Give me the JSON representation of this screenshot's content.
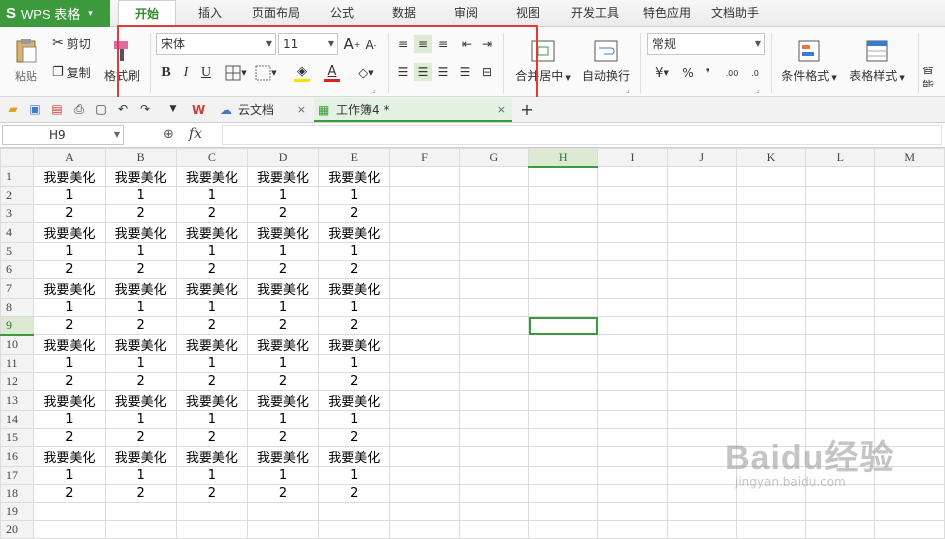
{
  "app": {
    "logo": "S",
    "name": "WPS 表格",
    "caret": "▾"
  },
  "menu_tabs": [
    "开始",
    "插入",
    "页面布局",
    "公式",
    "数据",
    "审阅",
    "视图",
    "开发工具",
    "特色应用",
    "文档助手"
  ],
  "ribbon": {
    "paste": "粘贴",
    "cut": "剪切",
    "copy": "复制",
    "format_painter": "格式刷",
    "font_name": "宋体",
    "font_size": "11",
    "merge_center": "合并居中",
    "auto_wrap": "自动换行",
    "number_format": "常规",
    "conditional_format": "条件格式",
    "table_style": "表格样式",
    "smart": "智能",
    "bold": "B",
    "italic": "I",
    "underline": "U",
    "grow_font": "A",
    "shrink_font": "A",
    "percent": "%",
    "comma": "❜",
    "inc_decimal": ".00",
    "dec_decimal": ".0",
    "font_color_bar": "#e02020",
    "fill_color_bar": "#f5e300"
  },
  "doc_tabs": [
    {
      "label": "",
      "close": "×"
    },
    {
      "label": "云文档",
      "close": "×"
    },
    {
      "label": "工作簿4 *",
      "close": "×"
    }
  ],
  "doc_tab_add": "+",
  "formula_bar": {
    "cell_ref": "H9",
    "fx": "fx",
    "value": ""
  },
  "sheet": {
    "columns": [
      "A",
      "B",
      "C",
      "D",
      "E",
      "F",
      "G",
      "H",
      "I",
      "J",
      "K",
      "L",
      "M"
    ],
    "selected_column": "H",
    "selected_row": "9",
    "rows": [
      {
        "n": "1",
        "cells": [
          "我要美化",
          "我要美化",
          "我要美化",
          "我要美化",
          "我要美化"
        ]
      },
      {
        "n": "2",
        "cells": [
          "1",
          "1",
          "1",
          "1",
          "1"
        ]
      },
      {
        "n": "3",
        "cells": [
          "2",
          "2",
          "2",
          "2",
          "2"
        ]
      },
      {
        "n": "4",
        "cells": [
          "我要美化",
          "我要美化",
          "我要美化",
          "我要美化",
          "我要美化"
        ]
      },
      {
        "n": "5",
        "cells": [
          "1",
          "1",
          "1",
          "1",
          "1"
        ]
      },
      {
        "n": "6",
        "cells": [
          "2",
          "2",
          "2",
          "2",
          "2"
        ]
      },
      {
        "n": "7",
        "cells": [
          "我要美化",
          "我要美化",
          "我要美化",
          "我要美化",
          "我要美化"
        ]
      },
      {
        "n": "8",
        "cells": [
          "1",
          "1",
          "1",
          "1",
          "1"
        ]
      },
      {
        "n": "9",
        "cells": [
          "2",
          "2",
          "2",
          "2",
          "2"
        ]
      },
      {
        "n": "10",
        "cells": [
          "我要美化",
          "我要美化",
          "我要美化",
          "我要美化",
          "我要美化"
        ]
      },
      {
        "n": "11",
        "cells": [
          "1",
          "1",
          "1",
          "1",
          "1"
        ]
      },
      {
        "n": "12",
        "cells": [
          "2",
          "2",
          "2",
          "2",
          "2"
        ]
      },
      {
        "n": "13",
        "cells": [
          "我要美化",
          "我要美化",
          "我要美化",
          "我要美化",
          "我要美化"
        ]
      },
      {
        "n": "14",
        "cells": [
          "1",
          "1",
          "1",
          "1",
          "1"
        ]
      },
      {
        "n": "15",
        "cells": [
          "2",
          "2",
          "2",
          "2",
          "2"
        ]
      },
      {
        "n": "16",
        "cells": [
          "我要美化",
          "我要美化",
          "我要美化",
          "我要美化",
          "我要美化"
        ]
      },
      {
        "n": "17",
        "cells": [
          "1",
          "1",
          "1",
          "1",
          "1"
        ]
      },
      {
        "n": "18",
        "cells": [
          "2",
          "2",
          "2",
          "2",
          "2"
        ]
      },
      {
        "n": "19",
        "cells": []
      },
      {
        "n": "20",
        "cells": []
      }
    ]
  },
  "watermark": {
    "brand": "Baidu经验",
    "url": "jingyan.baidu.com"
  },
  "colors": {
    "accent": "#3c9a3c",
    "highlight": "#e23a3a"
  }
}
